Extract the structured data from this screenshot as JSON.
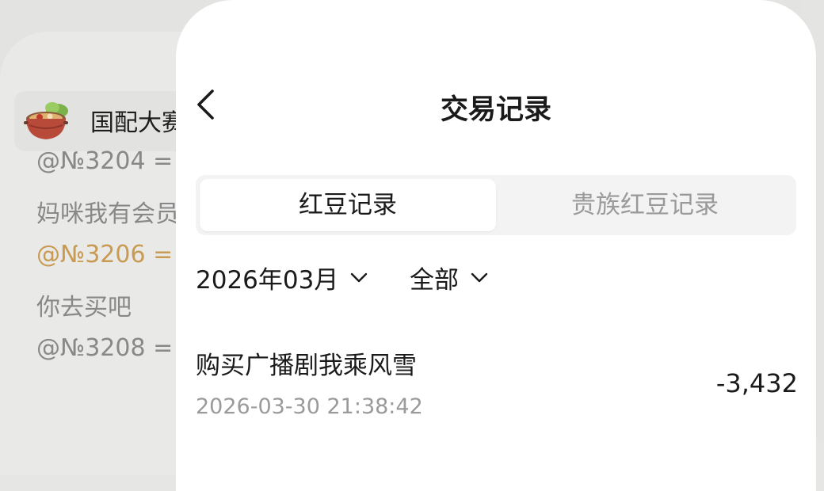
{
  "background_chat": {
    "group_name": "国配大赛",
    "avatar_icon": "hotpot-icon",
    "messages": [
      {
        "text": "@№3204 =",
        "highlight": false
      },
      {
        "text": "妈咪我有会员",
        "highlight": false
      },
      {
        "text": "@№3206 =",
        "highlight": true
      },
      {
        "text": "你去买吧",
        "highlight": false
      },
      {
        "text": "@№3208 =",
        "highlight": false
      }
    ],
    "highlight_color": "#c99a52"
  },
  "sheet": {
    "back_icon": "chevron-left-icon",
    "title": "交易记录",
    "tabs": [
      {
        "label": "红豆记录",
        "active": true
      },
      {
        "label": "贵族红豆记录",
        "active": false
      }
    ],
    "filters": {
      "month": "2026年03月",
      "category": "全部",
      "chevron_icon": "chevron-down-icon"
    },
    "transactions": [
      {
        "title": "购买广播剧我乘风雪",
        "time": "2026-03-30 21:38:42",
        "amount": "-3,432"
      }
    ]
  }
}
